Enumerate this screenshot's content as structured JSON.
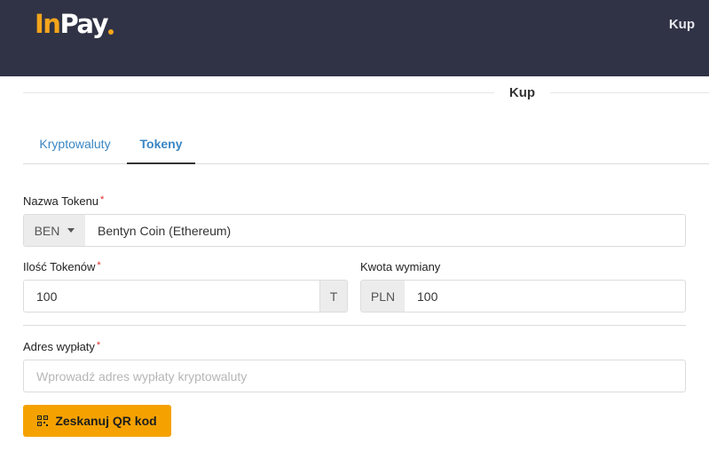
{
  "header": {
    "logo_part1": "In",
    "logo_part2": "Pay",
    "nav_buy": "Kup"
  },
  "page": {
    "title": "Kup"
  },
  "tabs": [
    {
      "label": "Kryptowaluty",
      "active": false
    },
    {
      "label": "Tokeny",
      "active": true
    }
  ],
  "form": {
    "token_name": {
      "label": "Nazwa Tokenu",
      "required": "*",
      "select_value": "BEN",
      "value": "Bentyn Coin (Ethereum)"
    },
    "token_amount": {
      "label": "Ilość Tokenów",
      "required": "*",
      "value": "100",
      "suffix": "T"
    },
    "exchange_amount": {
      "label": "Kwota wymiany",
      "currency": "PLN",
      "value": "100"
    },
    "payout_address": {
      "label": "Adres wypłaty",
      "required": "*",
      "value": "",
      "placeholder": "Wprowadź adres wypłaty kryptowaluty"
    },
    "scan_button": {
      "label": "Zeskanuj QR kod",
      "icon": "qr-code-icon"
    }
  },
  "colors": {
    "topbar": "#303345",
    "accent": "#f5a200",
    "link": "#3a86c4",
    "required": "#e02b2b"
  }
}
